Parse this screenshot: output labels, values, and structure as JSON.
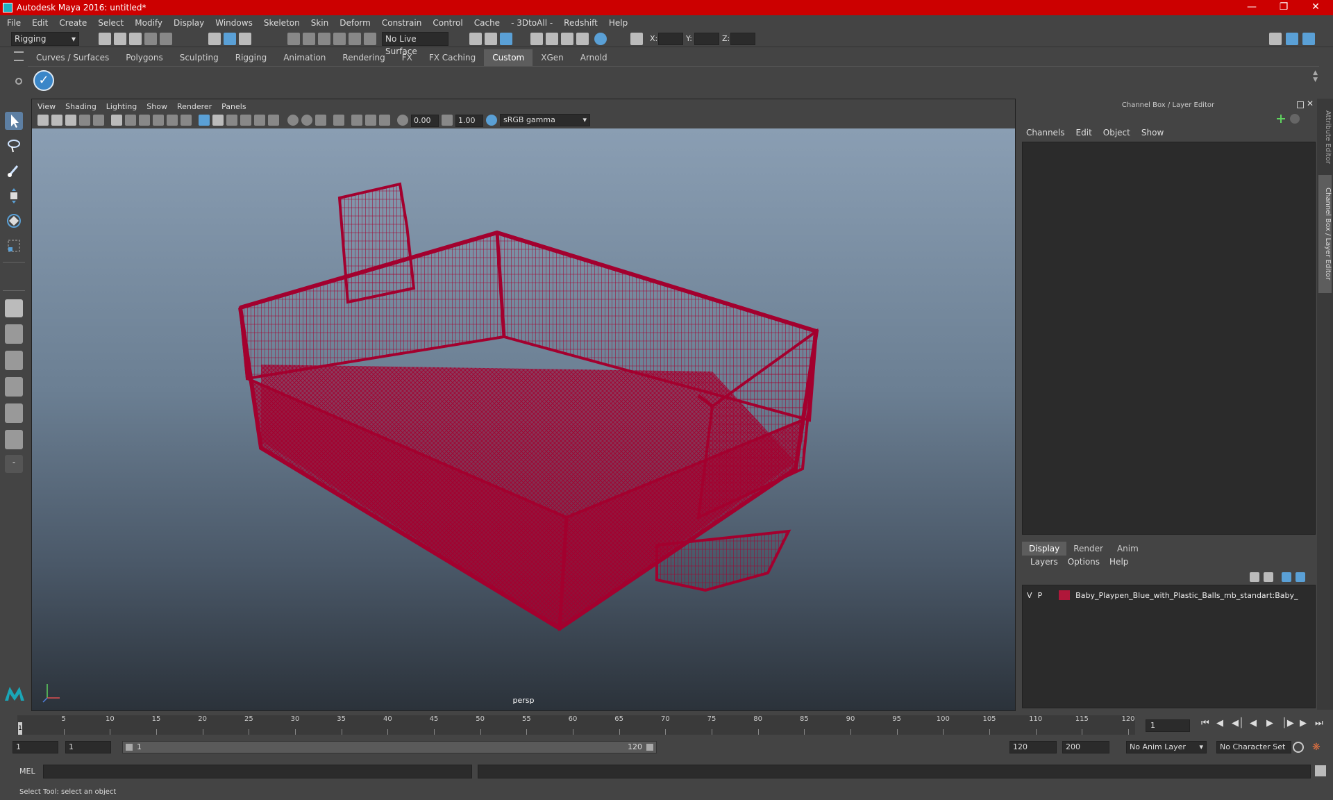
{
  "window": {
    "title": "Autodesk Maya 2016: untitled*"
  },
  "menubar": [
    "File",
    "Edit",
    "Create",
    "Select",
    "Modify",
    "Display",
    "Windows",
    "Skeleton",
    "Skin",
    "Deform",
    "Constrain",
    "Control",
    "Cache",
    "- 3DtoAll -",
    "Redshift",
    "Help"
  ],
  "status": {
    "menuset": "Rigging",
    "live_surface": "No Live Surface",
    "x_label": "X:",
    "y_label": "Y:",
    "z_label": "Z:"
  },
  "shelf": {
    "tabs": [
      "Curves / Surfaces",
      "Polygons",
      "Sculpting",
      "Rigging",
      "Animation",
      "Rendering",
      "FX",
      "FX Caching",
      "Custom",
      "XGen",
      "Arnold"
    ],
    "active": "Custom"
  },
  "viewport": {
    "menu": [
      "View",
      "Shading",
      "Lighting",
      "Show",
      "Renderer",
      "Panels"
    ],
    "exposure": "0.00",
    "gamma": "1.00",
    "colorspace": "sRGB gamma",
    "camera": "persp",
    "wire_color": "#a3002e"
  },
  "channel_box": {
    "title": "Channel Box / Layer Editor",
    "menu": [
      "Channels",
      "Edit",
      "Object",
      "Show"
    ],
    "layer_tabs": [
      "Display",
      "Render",
      "Anim"
    ],
    "layer_menu": [
      "Layers",
      "Options",
      "Help"
    ],
    "layer": {
      "v": "V",
      "p": "P",
      "name": "Baby_Playpen_Blue_with_Plastic_Balls_mb_standart:Baby_",
      "color": "#b0173a"
    }
  },
  "side_tabs": [
    "Attribute Editor",
    "Channel Box / Layer Editor"
  ],
  "timeline": {
    "ticks": [
      5,
      10,
      15,
      20,
      25,
      30,
      35,
      40,
      45,
      50,
      55,
      60,
      65,
      70,
      75,
      80,
      85,
      90,
      95,
      100,
      105,
      110,
      115,
      120
    ],
    "start_marker": "1",
    "current_frame": "1"
  },
  "range": {
    "start": "1",
    "anim_start": "1",
    "slider_start": "1",
    "slider_end": "120",
    "playback_end": "120",
    "anim_end": "200",
    "anim_layer": "No Anim Layer",
    "char_set": "No Character Set"
  },
  "command": {
    "lang": "MEL"
  },
  "help": "Select Tool: select an object"
}
